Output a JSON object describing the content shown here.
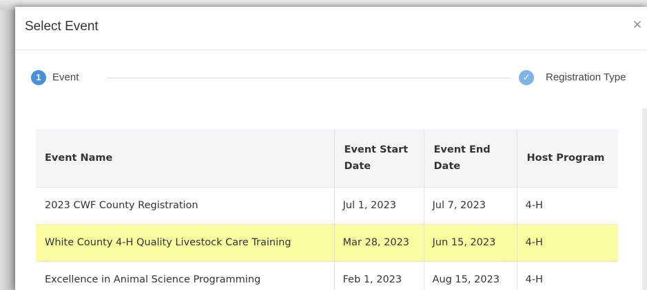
{
  "modal": {
    "title": "Select Event",
    "close_glyph": "×"
  },
  "stepper": {
    "steps": [
      {
        "number": "1",
        "label": "Event",
        "state": "active"
      },
      {
        "icon": "check-icon",
        "label": "Registration Type",
        "state": "complete"
      }
    ],
    "check_glyph": "✓"
  },
  "table": {
    "headers": [
      "Event Name",
      "Event Start Date",
      "Event End Date",
      "Host Program"
    ],
    "rows": [
      {
        "name": "2023 CWF County Registration",
        "start": "Jul 1, 2023",
        "end": "Jul 7, 2023",
        "host": "4-H",
        "highlighted": false
      },
      {
        "name": "White County 4-H Quality Livestock Care Training",
        "start": "Mar 28, 2023",
        "end": "Jun 15, 2023",
        "host": "4-H",
        "highlighted": true
      },
      {
        "name": "Excellence in Animal Science Programming",
        "start": "Feb 1, 2023",
        "end": "Aug 15, 2023",
        "host": "4-H",
        "highlighted": false
      }
    ]
  },
  "colors": {
    "accent": "#4a90d9",
    "highlight": "#fbfba0",
    "header_bg": "#f4f5f8"
  }
}
